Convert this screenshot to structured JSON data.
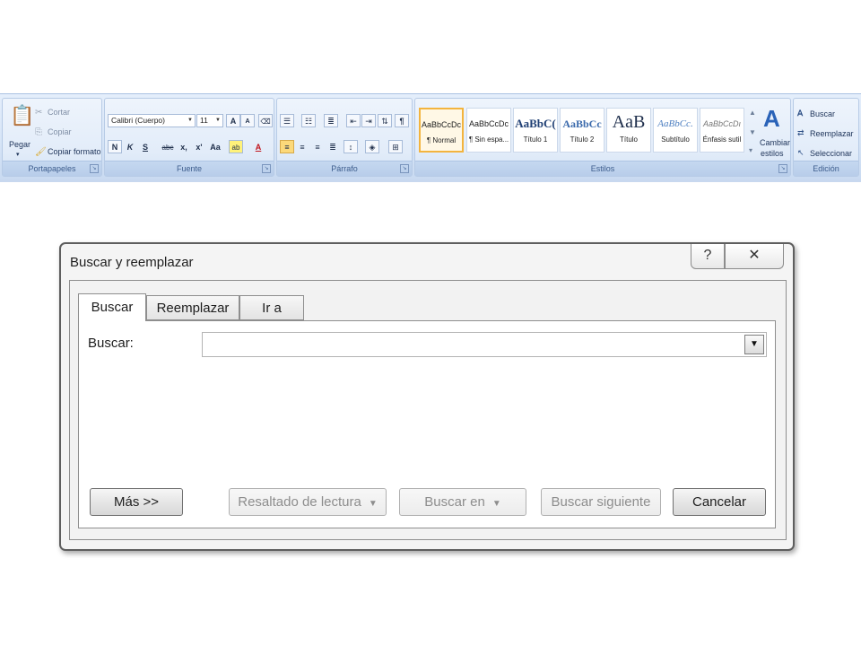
{
  "ribbon": {
    "clipboard": {
      "label": "Portapapeles",
      "paste": "Pegar",
      "cut": "Cortar",
      "copy": "Copiar",
      "format_painter": "Copiar formato"
    },
    "font": {
      "label": "Fuente",
      "font_name": "Calibri (Cuerpo)",
      "font_size": "11",
      "bold": "N",
      "italic": "K",
      "underline": "S",
      "strikethrough": "abc",
      "subscript": "x,",
      "superscript": "x'",
      "change_case": "Aa",
      "grow": "A",
      "shrink": "A",
      "highlight": "ab",
      "font_color": "A"
    },
    "paragraph": {
      "label": "Párrafo",
      "pilcrow": "¶"
    },
    "styles": {
      "label": "Estilos",
      "items": [
        {
          "preview": "AaBbCcDc",
          "name": "¶ Normal"
        },
        {
          "preview": "AaBbCcDc",
          "name": "¶ Sin espa..."
        },
        {
          "preview": "AaBbC(",
          "name": "Título 1"
        },
        {
          "preview": "AaBbCc",
          "name": "Título 2"
        },
        {
          "preview": "AaB",
          "name": "Título"
        },
        {
          "preview": "AaBbCc.",
          "name": "Subtítulo"
        },
        {
          "preview": "AaBbCcDı",
          "name": "Énfasis sutil"
        }
      ],
      "change_styles": "Cambiar",
      "change_styles_2": "estilos"
    },
    "editing": {
      "label": "Edición",
      "find": "Buscar",
      "replace": "Reemplazar",
      "select": "Seleccionar"
    }
  },
  "dialog": {
    "title": "Buscar y reemplazar",
    "help": "?",
    "close": "✕",
    "tabs": [
      "Buscar",
      "Reemplazar",
      "Ir a"
    ],
    "find_label": "Buscar:",
    "find_value": "",
    "buttons": {
      "more": "Más >>",
      "reading_highlight": "Resaltado de lectura",
      "find_in": "Buscar en",
      "find_next": "Buscar siguiente",
      "cancel": "Cancelar"
    }
  }
}
